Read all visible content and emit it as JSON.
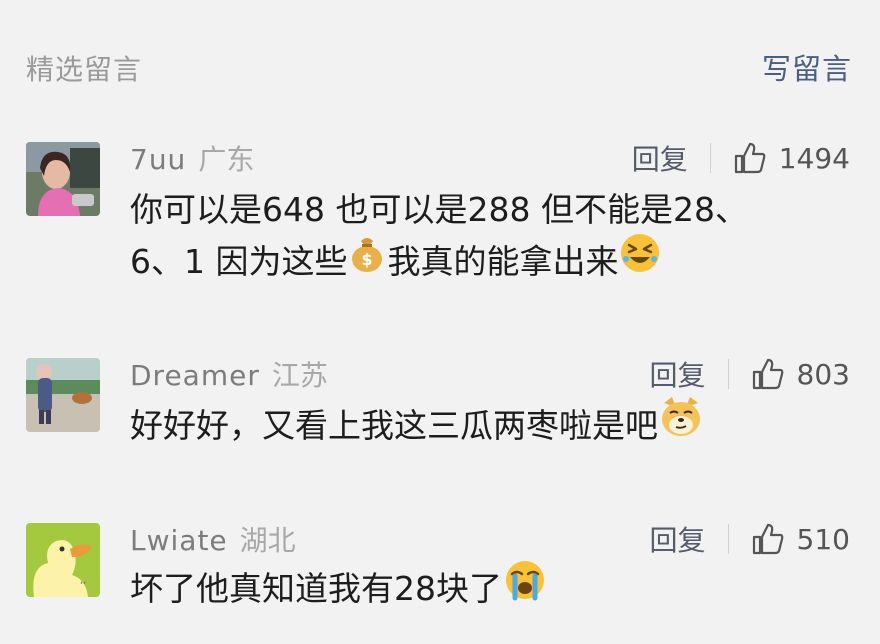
{
  "header": {
    "title": "精选留言",
    "write_label": "写留言"
  },
  "comments": [
    {
      "nickname": "7uu",
      "location": "广东",
      "reply_label": "回复",
      "likes": "1494",
      "text_line1": "你可以是648 也可以是288 但不能是28、",
      "text_line2_a": "6、1  因为这些",
      "text_line2_b": "我真的能拿出来",
      "emojis": [
        "money-bag-icon",
        "grinning-squint-face-icon"
      ]
    },
    {
      "nickname": "Dreamer",
      "location": "江苏",
      "reply_label": "回复",
      "likes": "803",
      "text_line1": "好好好，又看上我这三瓜两枣啦是吧",
      "emojis": [
        "doge-icon"
      ]
    },
    {
      "nickname": "Lwiate",
      "location": "湖北",
      "reply_label": "回复",
      "likes": "510",
      "text_line1": "坏了他真知道我有28块了",
      "emojis": [
        "loudly-crying-face-icon"
      ]
    }
  ],
  "colors": {
    "background": "#f2f2f2",
    "link": "#4a5d86",
    "muted": "#9a9a9a"
  }
}
